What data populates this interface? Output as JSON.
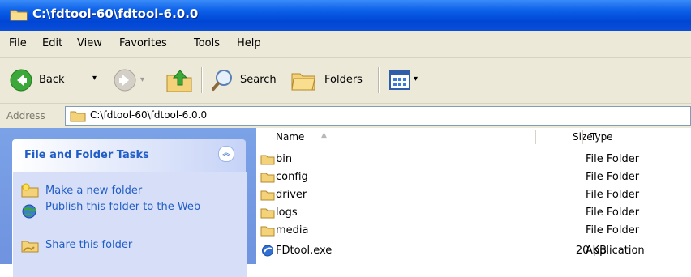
{
  "window": {
    "title": "C:\\fdtool-60\\fdtool-6.0.0"
  },
  "menu": {
    "items": [
      "File",
      "Edit",
      "View",
      "Favorites",
      "Tools",
      "Help"
    ]
  },
  "toolbar": {
    "back_label": "Back",
    "search_label": "Search",
    "folders_label": "Folders"
  },
  "address": {
    "label": "Address",
    "value": "C:\\fdtool-60\\fdtool-6.0.0"
  },
  "tasks": {
    "header": "File and Folder Tasks",
    "items": [
      {
        "label": "Make a new folder",
        "icon": "new-folder-icon"
      },
      {
        "label": "Publish this folder to the Web",
        "icon": "publish-web-icon"
      },
      {
        "label": "Share this folder",
        "icon": "share-folder-icon"
      }
    ]
  },
  "list": {
    "columns": [
      "Name",
      "Size",
      "Type"
    ],
    "rows": [
      {
        "name": "bin",
        "size": "",
        "type": "File Folder",
        "icon": "folder-icon"
      },
      {
        "name": "config",
        "size": "",
        "type": "File Folder",
        "icon": "folder-icon"
      },
      {
        "name": "driver",
        "size": "",
        "type": "File Folder",
        "icon": "folder-icon"
      },
      {
        "name": "logs",
        "size": "",
        "type": "File Folder",
        "icon": "folder-icon"
      },
      {
        "name": "media",
        "size": "",
        "type": "File Folder",
        "icon": "folder-icon"
      },
      {
        "name": "FDtool.exe",
        "size": "20 KB",
        "type": "Application",
        "icon": "application-icon"
      }
    ]
  },
  "colors": {
    "titlebar": "#0A5FE8",
    "task_link": "#215DC6",
    "chrome": "#ECE9D8"
  }
}
